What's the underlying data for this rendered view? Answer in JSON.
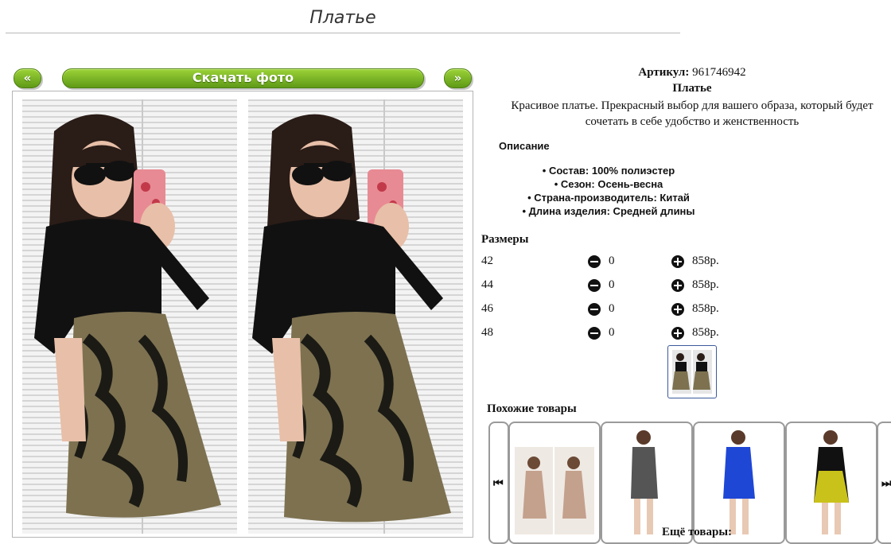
{
  "header": {
    "title": "Платье"
  },
  "gallery": {
    "prev_label": "«",
    "download_label": "Скачать фото",
    "next_label": "»"
  },
  "product": {
    "article_label": "Артикул:",
    "article_value": "961746942",
    "name": "Платье",
    "description": "Красивое платье. Прекрасный выбор для вашего образа, который будет сочетать в себе удобство и женственность",
    "description_heading": "Описание",
    "specs": [
      "Состав: 100% полиэстер",
      "Сезон: Осень-весна",
      "Страна-производитель: Китай",
      "Длина изделия: Средней длины"
    ]
  },
  "sizes": {
    "heading": "Размеры",
    "rows": [
      {
        "size": "42",
        "qty": "0",
        "price": "858р."
      },
      {
        "size": "44",
        "qty": "0",
        "price": "858р."
      },
      {
        "size": "46",
        "qty": "0",
        "price": "858р."
      },
      {
        "size": "48",
        "qty": "0",
        "price": "858р."
      }
    ]
  },
  "similar": {
    "heading": "Похожие товары",
    "prev_icon": "skip-back-icon",
    "next_icon": "skip-forward-icon",
    "more_label": "Ещё товары:"
  },
  "colors": {
    "button_green_top": "#9bd238",
    "button_green_bottom": "#5f9a17",
    "thumb_border": "#3b5a9a"
  }
}
